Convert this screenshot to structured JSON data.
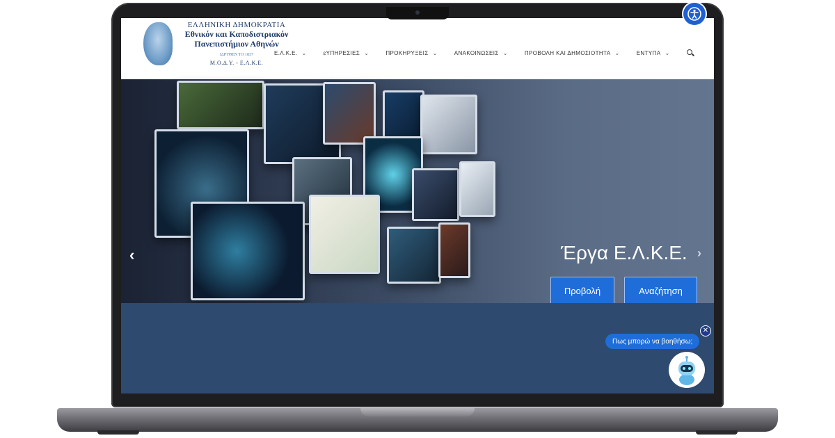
{
  "logo": {
    "line1": "ΕΛΛΗΝΙΚΗ ΔΗΜΟΚΡΑΤΙΑ",
    "line2": "Εθνικόν και Καποδιστριακόν",
    "line3": "Πανεπιστήμιον Αθηνών",
    "line4": "ΙΔΡΥΘΕΝ ΤΟ 1837",
    "line5": "Μ.Ο.Δ.Υ. - Ε.Λ.Κ.Ε."
  },
  "nav": {
    "items": [
      {
        "label": "Ε.Λ.Κ.Ε."
      },
      {
        "label": "ɛΥΠΗΡΕΣΙΕΣ"
      },
      {
        "label": "ΠΡΟΚΗΡΥΞΕΙΣ"
      },
      {
        "label": "ΑΝΑΚΟΙΝΩΣΕΙΣ"
      },
      {
        "label": "ΠΡΟΒΟΛΗ ΚΑΙ ΔΗΜΟΣΙΟΤΗΤΑ"
      },
      {
        "label": "ΕΝΤΥΠΑ"
      }
    ]
  },
  "hero": {
    "title": "Έργα Ε.Λ.Κ.Ε.",
    "button_view": "Προβολή",
    "button_search": "Αναζήτηση",
    "prev_glyph": "‹",
    "next_glyph": "›"
  },
  "chat": {
    "prompt": "Πως μπορώ να βοηθήσω;",
    "close_glyph": "✕"
  },
  "colors": {
    "accent": "#1f6dd8",
    "header_bg": "#ffffff",
    "lower_bg": "#2f4a6f"
  }
}
